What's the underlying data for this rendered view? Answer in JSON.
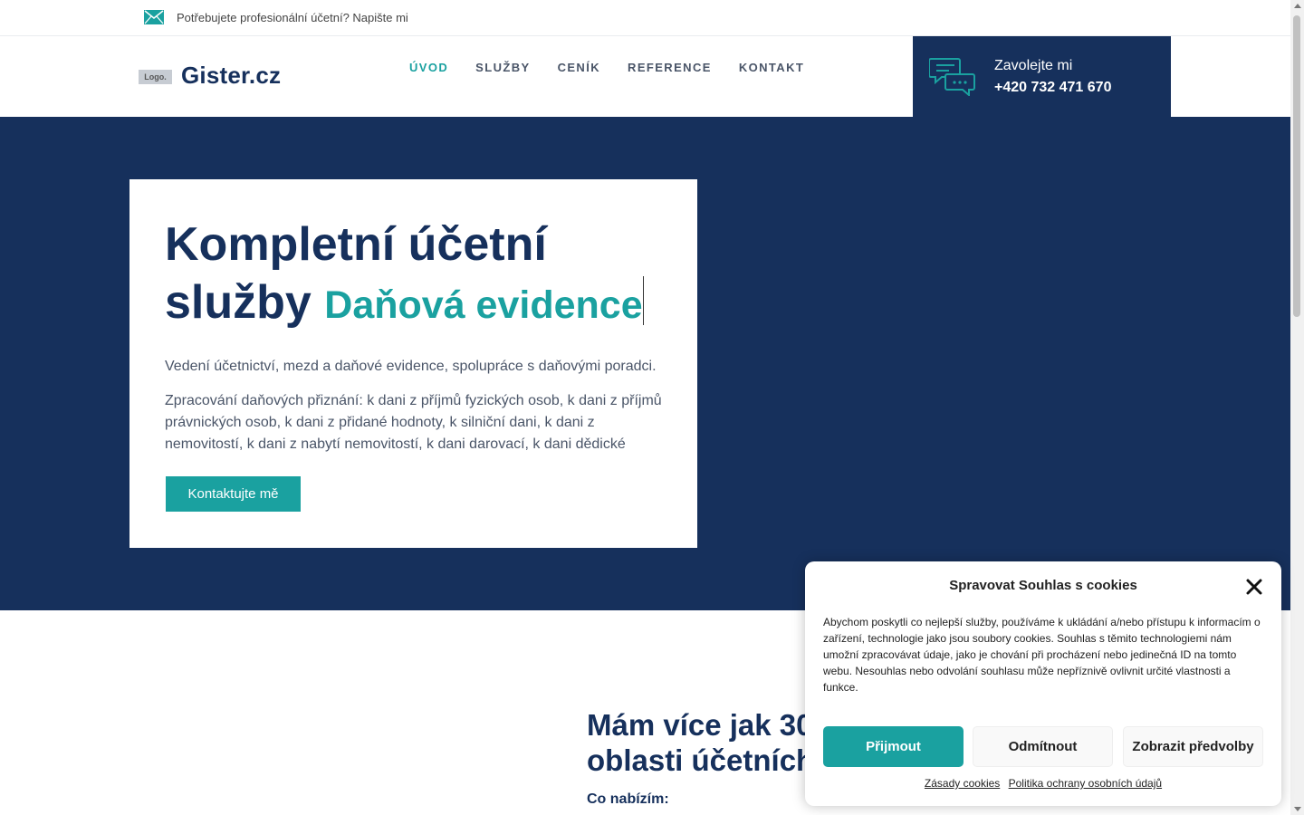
{
  "topbar": {
    "message": "Potřebujete profesionální účetní? Napište mi",
    "icon": "mail-icon"
  },
  "header": {
    "logo_badge": "Logo.",
    "logo_text": "Gister.cz",
    "nav": [
      {
        "label": "ÚVOD",
        "active": true
      },
      {
        "label": "SLUŽBY",
        "active": false
      },
      {
        "label": "CENÍK",
        "active": false
      },
      {
        "label": "REFERENCE",
        "active": false
      },
      {
        "label": "KONTAKT",
        "active": false
      }
    ],
    "call": {
      "icon": "chat-bubbles-icon",
      "label": "Zavolejte mi",
      "phone": "+420 732 471 670"
    }
  },
  "hero": {
    "headline": "Kompletní účetní služby",
    "typed_text": "Daňová evidence",
    "paragraph1": "Vedení účetnictví, mezd a daňové evidence, spolupráce s daňovými poradci.",
    "paragraph2": "Zpracování daňových přiznání: k dani z příjmů fyzických osob, k dani z příjmů právnických osob, k dani z přidané hodnoty, k silniční dani, k dani z nemovitostí, k dani z nabytí nemovitostí, k dani darovací, k dani dědické",
    "cta_label": "Kontaktujte mě"
  },
  "section": {
    "title_line1": "Mám více jak 30",
    "title_line2": "oblasti účetních",
    "subtitle": "Co nabízím:"
  },
  "cookie": {
    "title": "Spravovat Souhlas s cookies",
    "text": "Abychom poskytli co nejlepší služby, používáme k ukládání a/nebo přístupu k informacím o zařízení, technologie jako jsou soubory cookies. Souhlas s těmito technologiemi nám umožní zpracovávat údaje, jako je chování při procházení nebo jedinečná ID na tomto webu. Nesouhlas nebo odvolání souhlasu může nepříznivě ovlivnit určité vlastnosti a funkce.",
    "accept_label": "Přijmout",
    "deny_label": "Odmítnout",
    "prefs_label": "Zobrazit předvolby",
    "link1": "Zásady cookies",
    "link2": "Politika ochrany osobních údajů"
  },
  "colors": {
    "navy": "#16305c",
    "teal": "#1aa1a0"
  }
}
